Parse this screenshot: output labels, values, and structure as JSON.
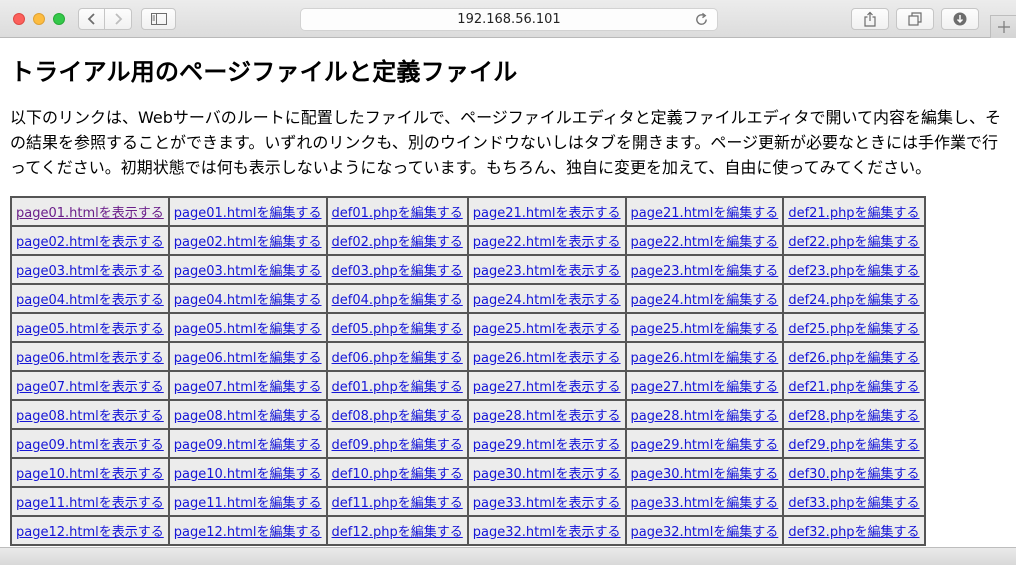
{
  "browser": {
    "address": "192.168.56.101"
  },
  "page": {
    "title": "トライアル用のページファイルと定義ファイル",
    "intro": "以下のリンクは、Webサーバのルートに配置したファイルで、ページファイルエディタと定義ファイルエディタで開いて内容を編集し、その結果を参照することができます。いずれのリンクも、別のウインドウないしはタブを開きます。ページ更新が必要なときには手作業で行ってください。初期状態では何も表示しないようになっています。もちろん、独自に変更を加えて、自由に使ってみてください。"
  },
  "table": {
    "rows": [
      [
        "page01.htmlを表示する",
        "page01.htmlを編集する",
        "def01.phpを編集する",
        "page21.htmlを表示する",
        "page21.htmlを編集する",
        "def21.phpを編集する"
      ],
      [
        "page02.htmlを表示する",
        "page02.htmlを編集する",
        "def02.phpを編集する",
        "page22.htmlを表示する",
        "page22.htmlを編集する",
        "def22.phpを編集する"
      ],
      [
        "page03.htmlを表示する",
        "page03.htmlを編集する",
        "def03.phpを編集する",
        "page23.htmlを表示する",
        "page23.htmlを編集する",
        "def23.phpを編集する"
      ],
      [
        "page04.htmlを表示する",
        "page04.htmlを編集する",
        "def04.phpを編集する",
        "page24.htmlを表示する",
        "page24.htmlを編集する",
        "def24.phpを編集する"
      ],
      [
        "page05.htmlを表示する",
        "page05.htmlを編集する",
        "def05.phpを編集する",
        "page25.htmlを表示する",
        "page25.htmlを編集する",
        "def25.phpを編集する"
      ],
      [
        "page06.htmlを表示する",
        "page06.htmlを編集する",
        "def06.phpを編集する",
        "page26.htmlを表示する",
        "page26.htmlを編集する",
        "def26.phpを編集する"
      ],
      [
        "page07.htmlを表示する",
        "page07.htmlを編集する",
        "def01.phpを編集する",
        "page27.htmlを表示する",
        "page27.htmlを編集する",
        "def21.phpを編集する"
      ],
      [
        "page08.htmlを表示する",
        "page08.htmlを編集する",
        "def08.phpを編集する",
        "page28.htmlを表示する",
        "page28.htmlを編集する",
        "def28.phpを編集する"
      ],
      [
        "page09.htmlを表示する",
        "page09.htmlを編集する",
        "def09.phpを編集する",
        "page29.htmlを表示する",
        "page29.htmlを編集する",
        "def29.phpを編集する"
      ],
      [
        "page10.htmlを表示する",
        "page10.htmlを編集する",
        "def10.phpを編集する",
        "page30.htmlを表示する",
        "page30.htmlを編集する",
        "def30.phpを編集する"
      ],
      [
        "page11.htmlを表示する",
        "page11.htmlを編集する",
        "def11.phpを編集する",
        "page33.htmlを表示する",
        "page33.htmlを編集する",
        "def33.phpを編集する"
      ],
      [
        "page12.htmlを表示する",
        "page12.htmlを編集する",
        "def12.phpを編集する",
        "page32.htmlを表示する",
        "page32.htmlを編集する",
        "def32.phpを編集する"
      ]
    ]
  },
  "colors": {
    "link": "#1515d6",
    "visited_link": "#6a1e8a"
  },
  "icons": [
    "chevron-left-icon",
    "chevron-right-icon",
    "sidebar-icon",
    "reload-icon",
    "share-icon",
    "tabs-icon",
    "download-icon",
    "plus-icon"
  ]
}
